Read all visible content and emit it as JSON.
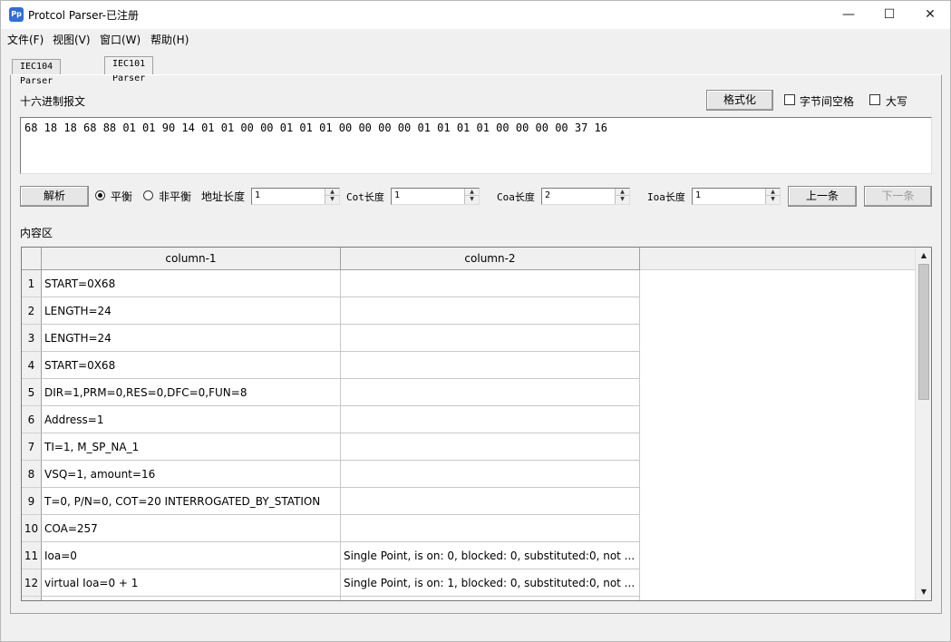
{
  "window": {
    "title": "Protcol Parser-已注册",
    "icon_text": "Pp"
  },
  "menu": [
    "文件(F)",
    "视图(V)",
    "窗口(W)",
    "帮助(H)"
  ],
  "tabs": [
    "IEC104 Parser",
    "IEC101 Parser"
  ],
  "active_tab": 1,
  "hex": {
    "label": "十六进制报文",
    "format_button": "格式化",
    "byte_space_label": "字节间空格",
    "uppercase_label": "大写",
    "value": "68 18 18 68 88 01 01 90 14 01 01 00 00 01 01 01 00 00 00 00 01 01 01 01 00 00 00 00 37 16"
  },
  "controls": {
    "parse_button": "解析",
    "balanced": "平衡",
    "unbalanced": "非平衡",
    "addr_len_label": "地址长度",
    "addr_len": "1",
    "cot_len_label": "Cot长度",
    "cot_len": "1",
    "coa_len_label": "Coa长度",
    "coa_len": "2",
    "ioa_len_label": "Ioa长度",
    "ioa_len": "1",
    "prev_button": "上一条",
    "next_button": "下一条"
  },
  "content": {
    "label": "内容区",
    "columns": [
      "column-1",
      "column-2"
    ],
    "rows": [
      {
        "n": "1",
        "c1": "START=0X68",
        "c2": ""
      },
      {
        "n": "2",
        "c1": "LENGTH=24",
        "c2": ""
      },
      {
        "n": "3",
        "c1": "LENGTH=24",
        "c2": ""
      },
      {
        "n": "4",
        "c1": "START=0X68",
        "c2": ""
      },
      {
        "n": "5",
        "c1": "DIR=1,PRM=0,RES=0,DFC=0,FUN=8",
        "c2": ""
      },
      {
        "n": "6",
        "c1": "Address=1",
        "c2": ""
      },
      {
        "n": "7",
        "c1": "TI=1, M_SP_NA_1",
        "c2": ""
      },
      {
        "n": "8",
        "c1": "VSQ=1, amount=16",
        "c2": ""
      },
      {
        "n": "9",
        "c1": "T=0, P/N=0, COT=20 INTERROGATED_BY_STATION",
        "c2": ""
      },
      {
        "n": "10",
        "c1": "COA=257",
        "c2": ""
      },
      {
        "n": "11",
        "c1": "Ioa=0",
        "c2": "Single Point, is on: 0, blocked: 0, substituted:0, not ..."
      },
      {
        "n": "12",
        "c1": "virtual Ioa=0 + 1",
        "c2": "Single Point, is on: 1, blocked: 0, substituted:0, not ..."
      }
    ]
  }
}
